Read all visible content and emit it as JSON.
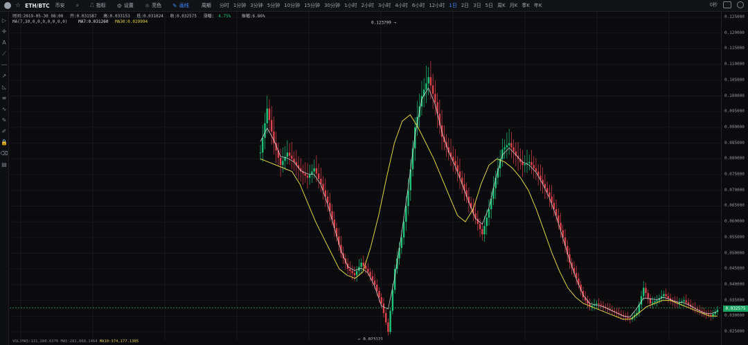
{
  "topbar": {
    "symbol": "ETH/BTC",
    "exchange": "币安",
    "indicators_label": "指标",
    "settings_label": "设置",
    "theme_label": "亮色",
    "draw_label": "画线",
    "period_label": "周期",
    "periods": [
      "分时",
      "1分钟",
      "3分钟",
      "5分钟",
      "10分钟",
      "15分钟",
      "30分钟",
      "1小时",
      "2小时",
      "3小时",
      "4小时",
      "6小时",
      "12小时",
      "1日",
      "2日",
      "3日",
      "5日",
      "周K",
      "月K",
      "季K",
      "年K"
    ],
    "selected_period": "1日",
    "right_label": "0秒"
  },
  "info": {
    "time": "时间:2019-05-30 08:00",
    "open": "开:0.031587",
    "high": "高:0.033153",
    "low": "低:0.031024",
    "close": "收:0.032575",
    "change_label": "涨幅:",
    "change_value": "4.75%",
    "amplitude": "振幅:6.86%"
  },
  "ma": {
    "params": "MA(7,30,0,0,0,0,0,0,0)",
    "ma7": "MA7:0.031260",
    "ma30": "MA30:0.029994"
  },
  "bottom": {
    "text": "VOL(MA5:131,280.6370",
    "text2": "MA5:281,868.1464",
    "text3": "MA10:374,177.1385"
  },
  "colors": {
    "up": "#1ec47a",
    "down": "#e0424b",
    "ma7": "#e6e6e6",
    "ma30": "#e3d744",
    "accent": "#3d8bff"
  },
  "chart_data": {
    "type": "line",
    "title": "",
    "ylim": [
      0.025,
      0.125
    ],
    "yticks": [
      "0.125000",
      "0.120000",
      "0.115000",
      "0.110000",
      "0.105000",
      "0.100000",
      "0.095000",
      "0.090000",
      "0.085000",
      "0.080000",
      "0.075000",
      "0.070000",
      "0.065000",
      "0.060000",
      "0.055000",
      "0.050000",
      "0.045000",
      "0.040000",
      "0.035000",
      "0.030000",
      "0.025000"
    ],
    "high_label": "0.123799",
    "low_label": "0.023121",
    "last_price": "0.032575",
    "price_path": [
      0.082,
      0.096,
      0.085,
      0.078,
      0.082,
      0.079,
      0.076,
      0.074,
      0.077,
      0.072,
      0.066,
      0.058,
      0.05,
      0.045,
      0.043,
      0.047,
      0.044,
      0.04,
      0.034,
      0.025,
      0.045,
      0.055,
      0.07,
      0.09,
      0.1,
      0.106,
      0.098,
      0.087,
      0.082,
      0.078,
      0.072,
      0.066,
      0.061,
      0.056,
      0.064,
      0.074,
      0.083,
      0.085,
      0.081,
      0.078,
      0.079,
      0.076,
      0.072,
      0.068,
      0.062,
      0.055,
      0.047,
      0.042,
      0.036,
      0.033,
      0.034,
      0.033,
      0.032,
      0.031,
      0.03,
      0.029,
      0.031,
      0.039,
      0.034,
      0.035,
      0.037,
      0.035,
      0.034,
      0.035,
      0.033,
      0.032,
      0.031,
      0.03,
      0.032
    ],
    "ma30_path": [
      0.08,
      0.079,
      0.078,
      0.077,
      0.076,
      0.072,
      0.066,
      0.06,
      0.055,
      0.05,
      0.045,
      0.043,
      0.042,
      0.044,
      0.052,
      0.062,
      0.074,
      0.085,
      0.092,
      0.094,
      0.09,
      0.085,
      0.08,
      0.074,
      0.068,
      0.062,
      0.06,
      0.064,
      0.072,
      0.078,
      0.08,
      0.079,
      0.077,
      0.074,
      0.07,
      0.064,
      0.057,
      0.05,
      0.044,
      0.039,
      0.036,
      0.034,
      0.033,
      0.032,
      0.031,
      0.03,
      0.029,
      0.029,
      0.031,
      0.033,
      0.034,
      0.035,
      0.035,
      0.034,
      0.033,
      0.032,
      0.031,
      0.03,
      0.03
    ]
  }
}
